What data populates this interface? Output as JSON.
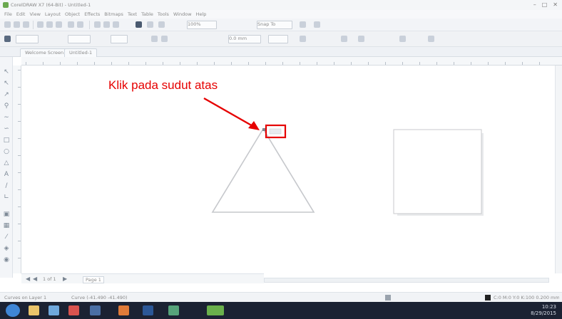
{
  "window": {
    "title": "CorelDRAW X7 (64-Bit) - Untitled-1"
  },
  "menu": [
    "File",
    "Edit",
    "View",
    "Layout",
    "Object",
    "Effects",
    "Bitmaps",
    "Text",
    "Table",
    "Tools",
    "Window",
    "Help"
  ],
  "toolbar": {
    "zoom_value": "100%",
    "snap_label": "Snap To",
    "property_value": "0.0 mm"
  },
  "tabs": [
    "Welcome Screen",
    "Untitled-1"
  ],
  "annotation": {
    "text": "Klik pada sudut atas",
    "color": "#e60000"
  },
  "page_nav": {
    "label": "1 of 1",
    "page": "Page 1"
  },
  "status": {
    "left": "Curves on Layer 1",
    "middle": "Curve (-41.490 -41.490)",
    "right": "C:0 M:0 Y:0 K:100  0.200 mm"
  },
  "clock": {
    "time": "10:23",
    "date": "8/29/2015"
  },
  "taskbar_apps": [
    "start",
    "explorer",
    "media",
    "acrobat",
    "mail",
    "presentation",
    "word",
    "paint",
    "coreldraw"
  ],
  "colors": {
    "accent": "#e60000",
    "taskbar": "#1b2233",
    "canvas": "#ffffff"
  }
}
